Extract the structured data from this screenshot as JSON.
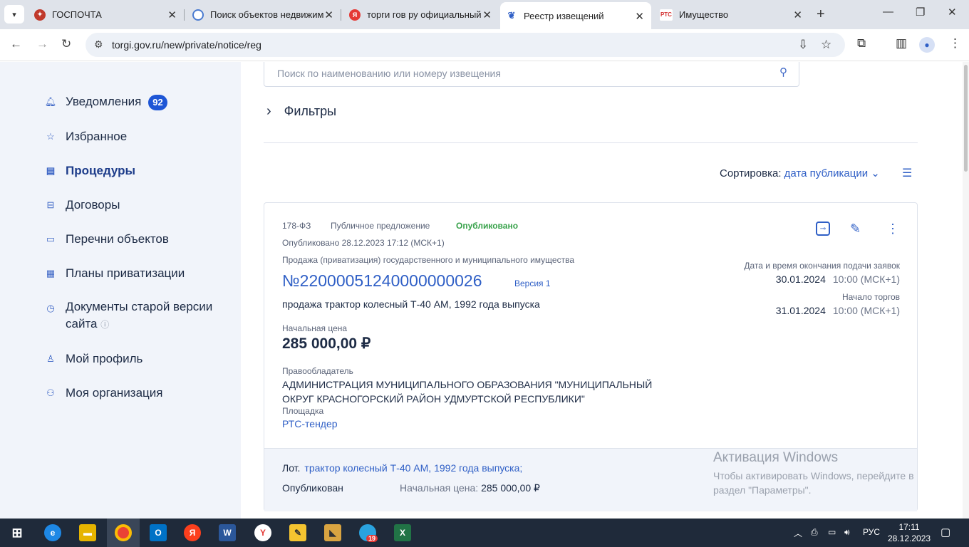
{
  "browser": {
    "tabs": [
      {
        "title": "ГОСПОЧТА",
        "favicon": "gospochta-icon",
        "color": "#c0392b"
      },
      {
        "title": "Поиск объектов недвижим",
        "favicon": "search-map-icon",
        "color": "#4a7bd0"
      },
      {
        "title": "торги гов ру официальный",
        "favicon": "yandex-icon",
        "color": "#e53935"
      },
      {
        "title": "Реестр извещений",
        "favicon": "torgi-emblem-icon",
        "color": "#2f5fc6"
      },
      {
        "title": "Имущество",
        "favicon": "rts-icon",
        "color": "#d32f2f"
      }
    ],
    "favicon_text": {
      "yandex": "Я",
      "rts": "РТС"
    },
    "url": "torgi.gov.ru/new/private/notice/reg"
  },
  "sidebar": {
    "items": [
      {
        "label": "Уведомления",
        "icon": "bell-icon",
        "badge": "92"
      },
      {
        "label": "Избранное",
        "icon": "star-icon"
      },
      {
        "label": "Процедуры",
        "icon": "document-icon",
        "active": true
      },
      {
        "label": "Договоры",
        "icon": "contract-icon"
      },
      {
        "label": "Перечни объектов",
        "icon": "list-icon"
      },
      {
        "label": "Планы приватизации",
        "icon": "calendar-icon"
      },
      {
        "label": "Документы старой версии",
        "label2": "сайта",
        "icon": "clock-icon"
      },
      {
        "label": "Мой профиль",
        "icon": "user-icon"
      },
      {
        "label": "Моя организация",
        "icon": "organization-icon"
      }
    ]
  },
  "search": {
    "placeholder": "Поиск по наименованию или номеру извещения"
  },
  "filters": {
    "label": "Фильтры"
  },
  "sort": {
    "label": "Сортировка:",
    "value": "дата публикации"
  },
  "notice": {
    "law": "178-ФЗ",
    "kind": "Публичное предложение",
    "status": "Опубликовано",
    "published": "Опубликовано 28.12.2023 17:12 (МСК+1)",
    "category": "Продажа (приватизация) государственного и муниципального имущества",
    "number": "№22000051240000000026",
    "version": "Версия 1",
    "description": "продажа трактор колесный Т-40 АМ, 1992 года выпуска",
    "price_label": "Начальная цена",
    "price": "285 000,00 ₽",
    "owner_label": "Правообладатель",
    "owner": "АДМИНИСТРАЦИЯ МУНИЦИПАЛЬНОГО ОБРАЗОВАНИЯ \"МУНИЦИПАЛЬНЫЙ ОКРУГ КРАСНОГОРСКИЙ РАЙОН УДМУРТСКОЙ РЕСПУБЛИКИ\"",
    "site_label": "Площадка",
    "site": "РТС-тендер",
    "deadline_label": "Дата и время окончания подачи заявок",
    "deadline_date": "30.01.2024",
    "deadline_time": "10:00 (МСК+1)",
    "start_label": "Начало торгов",
    "start_date": "31.01.2024",
    "start_time": "10:00 (МСК+1)",
    "lot_label": "Лот.",
    "lot_value": "трактор колесный Т-40 АМ, 1992 года выпуска;",
    "lot_status": "Опубликован",
    "lot_price_label": "Начальная цена:",
    "lot_price": "285 000,00 ₽"
  },
  "watermark": {
    "title": "Активация Windows",
    "line1": "Чтобы активировать Windows, перейдите в",
    "line2": "раздел \"Параметры\"."
  },
  "taskbar": {
    "lang": "РУС",
    "time": "17:11",
    "date": "28.12.2023",
    "icon_text": {
      "outlook": "O",
      "yandex": "Я",
      "word": "W",
      "yandex_browser": "Y",
      "excel": "X",
      "telegram": "19"
    }
  }
}
